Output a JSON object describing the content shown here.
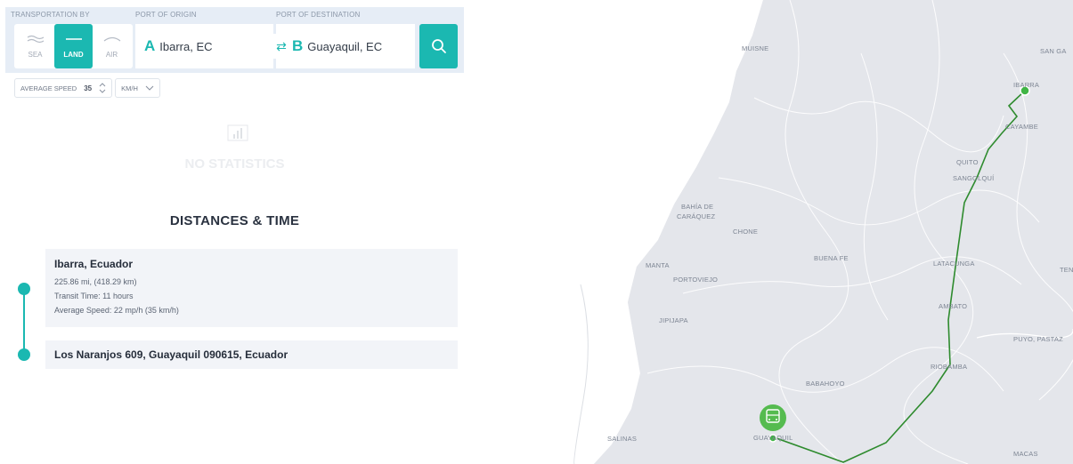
{
  "header": {
    "transport_label": "TRANSPORTATION BY",
    "origin_label": "PORT OF ORIGIN",
    "destination_label": "PORT OF DESTINATION",
    "modes": [
      {
        "label": "SEA",
        "icon": "wave-icon",
        "active": false
      },
      {
        "label": "LAND",
        "icon": "road-icon",
        "active": true
      },
      {
        "label": "AIR",
        "icon": "air-icon",
        "active": false
      }
    ],
    "origin": {
      "letter": "A",
      "value": "Ibarra, EC"
    },
    "destination": {
      "letter": "B",
      "value": "Guayaquil, EC"
    },
    "swap_icon": "swap-arrows-icon",
    "search_icon": "search-icon"
  },
  "speed": {
    "label": "AVERAGE SPEED",
    "value": "35",
    "unit": "KM/H"
  },
  "statistics": {
    "icon": "bar-chart-icon",
    "empty_text": "NO STATISTICS"
  },
  "distances": {
    "title": "DISTANCES & TIME",
    "origin": {
      "name": "Ibarra, Ecuador",
      "distance": "225.86 mi, (418.29 km)",
      "transit": "Transit Time: 11 hours",
      "speed": "Average Speed: 22 mp/h (35 km/h)"
    },
    "destination": {
      "name": "Los Naranjos 609, Guayaquil 090615, Ecuador"
    }
  },
  "map": {
    "route_color": "#2e8b2e",
    "accent": "#1bb8b1",
    "marker_icon": "truck-icon",
    "cities": [
      "MUISNE",
      "SAN GA",
      "IBARRA",
      "CAYAMBE",
      "QUITO",
      "SANGOLQUÍ",
      "BAHÍA DE",
      "CARÁQUEZ",
      "CHONE",
      "BUENA FE",
      "LATACUNGA",
      "TEN",
      "MANTA",
      "PORTOVIEJO",
      "AMBATO",
      "JIPIJAPA",
      "PUYO, PASTAZ",
      "RIOBAMBA",
      "BABAHOYO",
      "SALINAS",
      "GUAYAQUIL",
      "MACAS"
    ]
  }
}
